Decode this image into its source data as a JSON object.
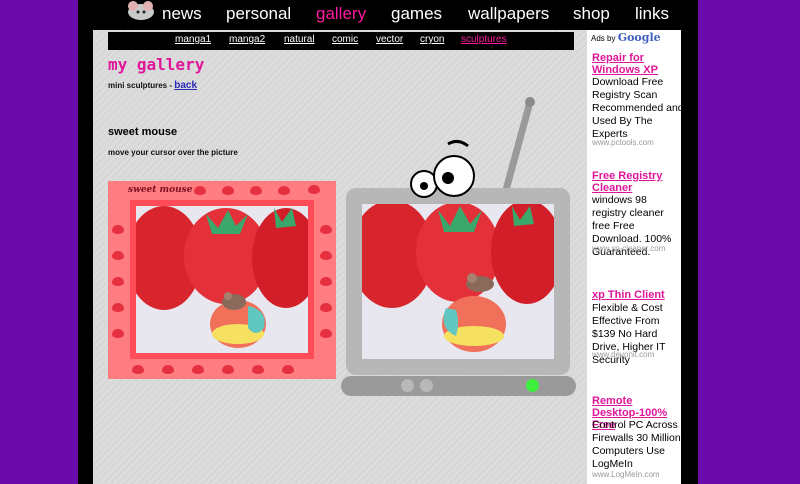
{
  "nav": {
    "items": [
      {
        "label": "news",
        "active": false
      },
      {
        "label": "personal",
        "active": false
      },
      {
        "label": "gallery",
        "active": true
      },
      {
        "label": "games",
        "active": false
      },
      {
        "label": "wallpapers",
        "active": false
      },
      {
        "label": "shop",
        "active": false
      },
      {
        "label": "links",
        "active": false
      }
    ]
  },
  "subnav": {
    "items": [
      {
        "label": "manga1",
        "active": false
      },
      {
        "label": "manga2",
        "active": false
      },
      {
        "label": "natural",
        "active": false
      },
      {
        "label": "comic",
        "active": false
      },
      {
        "label": "vector",
        "active": false
      },
      {
        "label": "cryon",
        "active": false
      },
      {
        "label": "sculptures",
        "active": true
      }
    ]
  },
  "page": {
    "title": "my gallery",
    "subtitle": "mini sculptures - ",
    "back_label": "back",
    "section_title": "sweet mouse",
    "instruction": "move your cursor over the picture",
    "frame_label": "sweet mouse"
  },
  "ads": {
    "header_prefix": "Ads by ",
    "header_brand": "Google",
    "items": [
      {
        "title": "Repair for Windows XP",
        "text": "Download Free Registry Scan Recommended and Used By The Experts",
        "url": "www.pctools.com"
      },
      {
        "title": "Free Registry Cleaner",
        "text": "windows 98 registry cleaner free Free Download. 100% Guaranteed.",
        "url": "www.xp-cleaner.com"
      },
      {
        "title": "xp Thin Client",
        "text": "Flexible & Cost Effective From $139 No Hard Drive, Higher IT Security",
        "url": "www.devonit.com"
      },
      {
        "title": "Remote Desktop-100% Free",
        "text": "Control PC Across Firewalls 30 Million Computers Use LogMeIn",
        "url": "www.LogMeIn.com"
      }
    ]
  },
  "colors": {
    "background": "#6a0aa8",
    "accent_pink": "#e0169a",
    "power_light": "#3cf03c"
  }
}
